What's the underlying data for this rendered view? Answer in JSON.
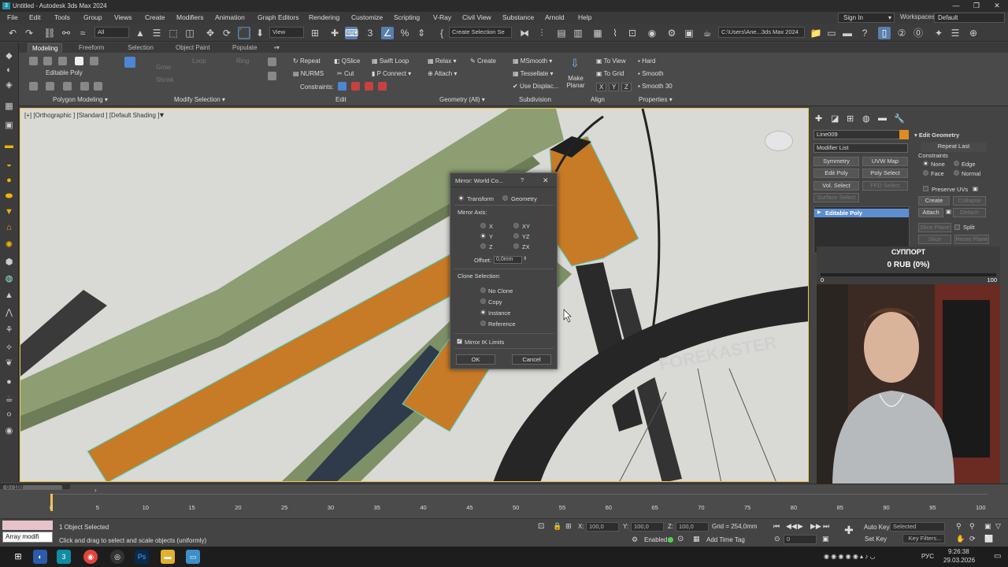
{
  "window": {
    "title": "Untitled - Autodesk 3ds Max 2024",
    "minimize": "—",
    "maximize": "❐",
    "close": "✕"
  },
  "menu": {
    "items": [
      "File",
      "Edit",
      "Tools",
      "Group",
      "Views",
      "Create",
      "Modifiers",
      "Animation",
      "Graph Editors",
      "Rendering",
      "Customize",
      "Scripting",
      "V-Ray",
      "Civil View",
      "Substance",
      "Arnold",
      "Help"
    ],
    "sign_in": "Sign In",
    "workspaces_label": "Workspaces:",
    "workspaces_value": "Default"
  },
  "toolbar": {
    "filter_value": "All",
    "ref_coord": "View",
    "named_selection": "Create Selection Se",
    "project_path": "C:\\Users\\Ane...3ds Max 2024"
  },
  "ribbon": {
    "tabs": [
      "Modeling",
      "Freeform",
      "Selection",
      "Object Paint",
      "Populate"
    ],
    "active_tab": "Modeling",
    "editable_poly": "Editable Poly",
    "grow": "Grow",
    "shrink": "Shrink",
    "loop": "Loop",
    "ring": "Ring",
    "repeat": "Repeat",
    "qslice": "QSlice",
    "swift_loop": "Swift Loop",
    "nurms": "NURMS",
    "cut": "Cut",
    "p_connect": "P Connect",
    "constraints": "Constraints:",
    "relax": "Relax",
    "create": "Create",
    "attach": "Attach",
    "msmooth": "MSmooth",
    "tessellate": "Tessellate",
    "use_displac": "Use Displac...",
    "make_planar": "Make Planar",
    "to_view": "To View",
    "to_grid": "To Grid",
    "hard": "Hard",
    "smooth": "Smooth",
    "smooth30": "Smooth 30",
    "xyz": [
      "X",
      "Y",
      "Z"
    ],
    "groups": [
      "Polygon Modeling",
      "Modify Selection",
      "Edit",
      "Geometry (All)",
      "Subdivision",
      "Align",
      "Properties"
    ]
  },
  "viewport": {
    "label": "[+] [Orthographic ] [Standard ] [Default Shading ]",
    "tire_text": "FOREKASTER"
  },
  "mirror_dialog": {
    "title": "Mirror: World Co...",
    "help": "?",
    "close": "✕",
    "transform": "Transform",
    "geometry": "Geometry",
    "mirror_axis": "Mirror Axis:",
    "axes": [
      "X",
      "Y",
      "Z",
      "XY",
      "YZ",
      "ZX"
    ],
    "selected_axis": "Y",
    "offset_label": "Offset:",
    "offset_value": "0,0mm",
    "clone_selection": "Clone Selection:",
    "clone_options": [
      "No Clone",
      "Copy",
      "Instance",
      "Reference"
    ],
    "selected_clone": "Instance",
    "mirror_ik": "Mirror IK Limits",
    "ok": "OK",
    "cancel": "Cancel"
  },
  "command_panel": {
    "object_name": "Line009",
    "modifier_list": "Modifier List",
    "buttons": [
      "Symmetry",
      "UVW Map",
      "Edit Poly",
      "Poly Select",
      "Vol. Select",
      "FFD Select",
      "Surface Select"
    ],
    "stack_item": "Editable Poly",
    "edit_geometry": "Edit Geometry",
    "repeat_last": "Repeat Last",
    "constraints": "Constraints",
    "none": "None",
    "edge": "Edge",
    "face": "Face",
    "normal": "Normal",
    "preserve_uvs": "Preserve UVs",
    "create": "Create",
    "collapse": "Collapse",
    "attach": "Attach",
    "detach": "Detach",
    "slice_plane": "Slice Plane",
    "split": "Split",
    "slice": "Slice",
    "reset_plane": "Reset Plane"
  },
  "support": {
    "title": "СУППОРТ",
    "amount": "0 RUB (0%)",
    "min": "0",
    "max": "100"
  },
  "timeline": {
    "frame_counter": "0 / 100",
    "ticks": [
      "0",
      "5",
      "10",
      "15",
      "20",
      "25",
      "30",
      "35",
      "40",
      "45",
      "50",
      "55",
      "60",
      "65",
      "70",
      "75",
      "80",
      "85",
      "90",
      "95",
      "100"
    ]
  },
  "status": {
    "script_label": "Array modifi",
    "objects_selected": "1 Object Selected",
    "prompt": "Click and drag to select and scale objects (uniformly)",
    "x_label": "X:",
    "x_value": "100,0",
    "y_label": "Y:",
    "y_value": "100,0",
    "z_label": "Z:",
    "z_value": "100,0",
    "grid": "Grid = 254,0mm",
    "enabled": "Enabled:",
    "add_time_tag": "Add Time Tag",
    "auto_key": "Auto Key",
    "selected": "Selected",
    "set_key": "Set Key",
    "key_filters": "Key Filters...",
    "frame": "0"
  },
  "taskbar": {
    "time": "9:26:38",
    "date": "29.03.2026",
    "lang": "РУС"
  }
}
